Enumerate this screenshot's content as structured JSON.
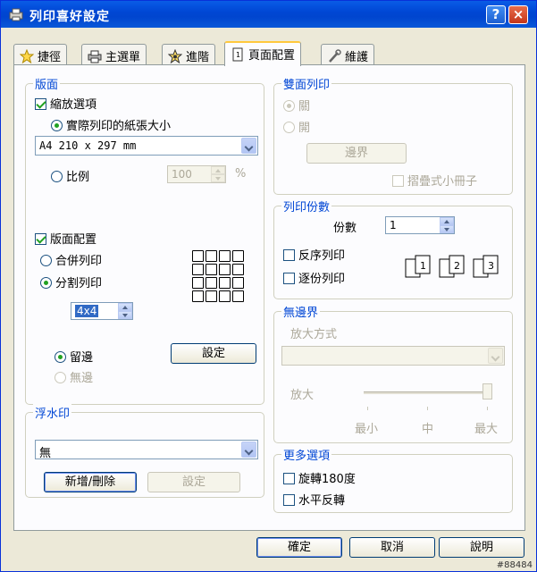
{
  "window": {
    "title": "列印喜好設定",
    "help_label": "?",
    "close_label": "×"
  },
  "tabs": [
    {
      "label": "捷徑",
      "icon": "star-icon"
    },
    {
      "label": "主選單",
      "icon": "printer-icon"
    },
    {
      "label": "進階",
      "icon": "advanced-icon"
    },
    {
      "label": "頁面配置",
      "icon": "page-layout-icon",
      "active": true
    },
    {
      "label": "維護",
      "icon": "wrench-icon"
    }
  ],
  "layout_group": {
    "legend": "版面",
    "scaling_label": "縮放選項",
    "actual_paper_label": "實際列印的紙張大小",
    "paper_size": "A4 210 x 297 mm",
    "percent_label": "比例",
    "percent_value": "100",
    "percent_unit": "%",
    "page_layout_label": "版面配置",
    "nup_label": "合併列印",
    "poster_label": "分割列印",
    "poster_value": "4x4",
    "margins_label": "留邊",
    "no_margins_label": "無邊",
    "settings_button": "設定"
  },
  "duplex_group": {
    "legend": "雙面列印",
    "off_label": "關",
    "on_label": "開",
    "margins_button": "邊界",
    "booklet_label": "摺疊式小冊子"
  },
  "copies_group": {
    "legend": "列印份數",
    "copies_label": "份數",
    "copies_value": "1",
    "reverse_label": "反序列印",
    "collate_label": "逐份列印"
  },
  "borderless_group": {
    "legend": "無邊界",
    "method_label": "放大方式",
    "expansion_label": "放大",
    "level_min": "最小",
    "level_mid": "中",
    "level_max": "最大",
    "expansion_level": 1.0
  },
  "watermark_group": {
    "legend": "浮水印",
    "value": "無",
    "add_delete_button": "新增/刪除",
    "settings_button": "設定"
  },
  "more_options_group": {
    "legend": "更多選項",
    "rotate_label": "旋轉180度",
    "mirror_label": "水平反轉"
  },
  "footer": {
    "ok": "確定",
    "cancel": "取消",
    "help": "說明"
  },
  "image_tag": "#88484"
}
